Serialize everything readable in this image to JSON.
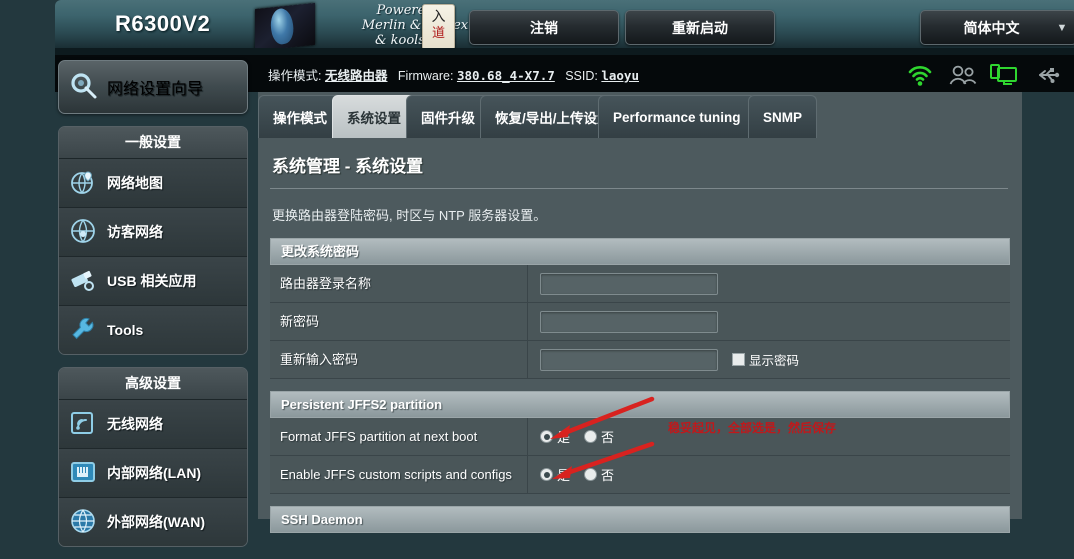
{
  "header": {
    "model": "R6300V2",
    "powered_by": [
      "Powered by",
      "Merlin & Vortex",
      "& koolshare"
    ],
    "tile_top": "入",
    "tile_bottom": "道",
    "logout_label": "注销",
    "reboot_label": "重新启动",
    "language_label": "简体中文",
    "caret": "▼"
  },
  "infobar": {
    "mode_label": "操作模式:",
    "mode_value": "无线路由器",
    "firmware_label": "Firmware:",
    "firmware_value": "380.68_4-X7.7",
    "ssid_label": "SSID:",
    "ssid_value": "laoyu",
    "icons": [
      "wifi-icon",
      "guests-icon",
      "clients-icon",
      "usb-icon"
    ],
    "colors": {
      "wifi": "#2fd62f",
      "clients": "#2fd62f",
      "inactive": "#9aa3a6"
    }
  },
  "sidebar": {
    "wizard": {
      "label": "网络设置向导",
      "icon": "wizard-gear-icon"
    },
    "groups": [
      {
        "title": "一般设置",
        "items": [
          {
            "label": "网络地图",
            "icon": "globe-pin-icon"
          },
          {
            "label": "访客网络",
            "icon": "globe-guest-icon"
          },
          {
            "label": "USB 相关应用",
            "icon": "usb-apps-icon"
          },
          {
            "label": "Tools",
            "icon": "wrench-icon"
          }
        ]
      },
      {
        "title": "高级设置",
        "items": [
          {
            "label": "无线网络",
            "icon": "wireless-icon"
          },
          {
            "label": "内部网络(LAN)",
            "icon": "lan-port-icon"
          },
          {
            "label": "外部网络(WAN)",
            "icon": "wan-globe-icon"
          }
        ]
      }
    ]
  },
  "tabs": [
    {
      "label": "操作模式",
      "active": false
    },
    {
      "label": "系统设置",
      "active": true
    },
    {
      "label": "固件升级",
      "active": false
    },
    {
      "label": "恢复/导出/上传设置",
      "active": false
    },
    {
      "label": "Performance tuning",
      "active": false
    },
    {
      "label": "SNMP",
      "active": false
    }
  ],
  "main": {
    "page_title": "系统管理 - 系统设置",
    "page_desc": "更换路由器登陆密码, 时区与 NTP 服务器设置。",
    "sections": [
      {
        "title": "更改系统密码",
        "rows": [
          {
            "label": "路由器登录名称",
            "type": "text",
            "value": "",
            "placeholder": ""
          },
          {
            "label": "新密码",
            "type": "text",
            "value": "",
            "placeholder": ""
          },
          {
            "label": "重新输入密码",
            "type": "text",
            "value": "",
            "placeholder": "",
            "checkbox_label": "显示密码",
            "checkbox_checked": false
          }
        ]
      },
      {
        "title": "Persistent JFFS2 partition",
        "rows": [
          {
            "label": "Format JFFS partition at next boot",
            "type": "radio",
            "yes_label": "是",
            "no_label": "否",
            "selected": "yes"
          },
          {
            "label": "Enable JFFS custom scripts and configs",
            "type": "radio",
            "yes_label": "是",
            "no_label": "否",
            "selected": "yes"
          }
        ]
      },
      {
        "title": "SSH Daemon",
        "rows": []
      }
    ],
    "annotation": {
      "text": "稳妥起见，全部选是，然后保存",
      "color": "#c0181b"
    }
  }
}
